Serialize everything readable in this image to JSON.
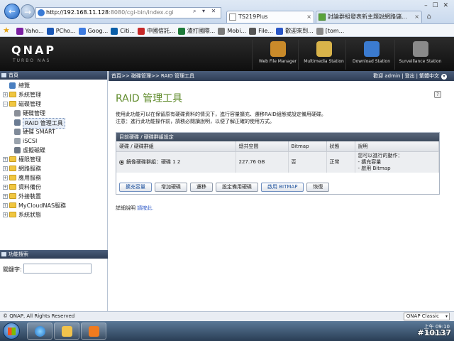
{
  "browser": {
    "address_host": "http://192.168.11.128",
    "address_rest": ":8080/cgi-bin/index.cgi",
    "address_controls": "⌕ ▾ ✕",
    "tabs": [
      {
        "label": "TS219Plus",
        "close": "×"
      },
      {
        "label": "討論群組發表新主題說網路儲...",
        "close": "×"
      }
    ],
    "window_controls": "– ☐ ✕",
    "home_icon": "⌂",
    "favorites": [
      {
        "label": "Yaho...",
        "color": "#7b1fa2"
      },
      {
        "label": "PCho...",
        "color": "#1a57b5"
      },
      {
        "label": "Goog...",
        "color": "#3d7be0"
      },
      {
        "label": "Citi...",
        "color": "#0a5ea8"
      },
      {
        "label": "中國信託...",
        "color": "#c62828"
      },
      {
        "label": "渣打國際...",
        "color": "#1e7a3a"
      },
      {
        "label": "Mobi...",
        "color": "#7a7a7a"
      },
      {
        "label": "File...",
        "color": "#555555"
      },
      {
        "label": "歡迎來到...",
        "color": "#2a56c6"
      },
      {
        "label": "[tom...",
        "color": "#888888"
      }
    ]
  },
  "qnap": {
    "logo": "QNAP",
    "subtitle": "TURBO NAS",
    "stations": [
      {
        "label": "Web File Manager",
        "color": "#c98a2a"
      },
      {
        "label": "Multimedia Station",
        "color": "#d8b34a"
      },
      {
        "label": "Download Station",
        "color": "#3b7bd0"
      },
      {
        "label": "Surveillance Station",
        "color": "#8a8a8a"
      }
    ]
  },
  "nav": {
    "header": "首頁",
    "items": [
      {
        "label": "總覽",
        "level": 0,
        "kind": "icon",
        "color": "#4a7fc0",
        "expander": ""
      },
      {
        "label": "系統管理",
        "level": 0,
        "kind": "folder",
        "expander": "+"
      },
      {
        "label": "磁碟管理",
        "level": 0,
        "kind": "folder",
        "expander": "−"
      },
      {
        "label": "硬碟管理",
        "level": 1,
        "kind": "icon",
        "color": "#8a8f98"
      },
      {
        "label": "RAID 管理工具",
        "level": 1,
        "kind": "icon",
        "color": "#6b7c93",
        "selected": true
      },
      {
        "label": "硬碟 SMART",
        "level": 1,
        "kind": "icon",
        "color": "#7f8a99"
      },
      {
        "label": "iSCSI",
        "level": 1,
        "kind": "icon",
        "color": "#9aa3ad"
      },
      {
        "label": "虛擬磁碟",
        "level": 1,
        "kind": "icon",
        "color": "#6d7785"
      },
      {
        "label": "權限管理",
        "level": 0,
        "kind": "folder",
        "expander": "+"
      },
      {
        "label": "網路服務",
        "level": 0,
        "kind": "folder",
        "expander": "+"
      },
      {
        "label": "應用服務",
        "level": 0,
        "kind": "folder",
        "expander": "+"
      },
      {
        "label": "資料備份",
        "level": 0,
        "kind": "folder",
        "expander": "+"
      },
      {
        "label": "外接裝置",
        "level": 0,
        "kind": "folder",
        "expander": "+"
      },
      {
        "label": "MyCloudNAS服務",
        "level": 0,
        "kind": "folder",
        "expander": "+"
      },
      {
        "label": "系統狀態",
        "level": 0,
        "kind": "folder",
        "expander": "+"
      }
    ],
    "search": {
      "header": "功能搜索",
      "label": "關鍵字:",
      "value": ""
    }
  },
  "breadcrumb": {
    "path": "首頁>> 磁碟管理>> RAID 管理工具",
    "welcome": "歡迎 admin",
    "logout": "登出",
    "language": "繁體中文",
    "lang_dropdown": "▾"
  },
  "main": {
    "title": "RAID 管理工具",
    "help_icon": "?",
    "desc_line1": "使用此功能可以在保留原有硬碟資料的情況下，進行容量擴充、遷移RAID組態或設定備用硬碟。",
    "desc_line2": "注意：進行此功能操作前，請務必閱讀說明，以便了解正確的使用方式。",
    "panel_title": "目前硬碟 / 硬碟群組設定",
    "columns": [
      "硬碟 / 硬碟群組",
      "總共空間",
      "Bitmap",
      "狀態",
      "說明"
    ],
    "row": {
      "volume": "鏡像硬碟群組：硬碟 1 2",
      "space": "227.76 GB",
      "bitmap": "否",
      "status": "正常",
      "actions_title": "您可以進行的動作：",
      "action1": "- 擴充容量",
      "action2": "- 啟用 Bitmap"
    },
    "buttons": [
      {
        "label": "擴充容量",
        "blue": true
      },
      {
        "label": "增加硬碟",
        "blue": false
      },
      {
        "label": "遷移",
        "blue": false
      },
      {
        "label": "設定備用硬碟",
        "blue": false
      },
      {
        "label": "啟用 BITMAP",
        "blue": true
      },
      {
        "label": "恢復",
        "blue": false
      }
    ],
    "more_prefix": "詳細說明",
    "more_link": "請按此."
  },
  "footer": {
    "copyright": "© QNAP, All Rights Reserved",
    "theme": "QNAP Classic",
    "theme_dropdown": "▾"
  },
  "taskbar": {
    "tray_line1": "上午 09:10",
    "tray_line2": "2011/11/7",
    "watermark": "#10137"
  },
  "colors": {
    "title_green": "#5f8b2b",
    "header_navy": "#2e3d55",
    "link_blue": "#2a56c6"
  }
}
